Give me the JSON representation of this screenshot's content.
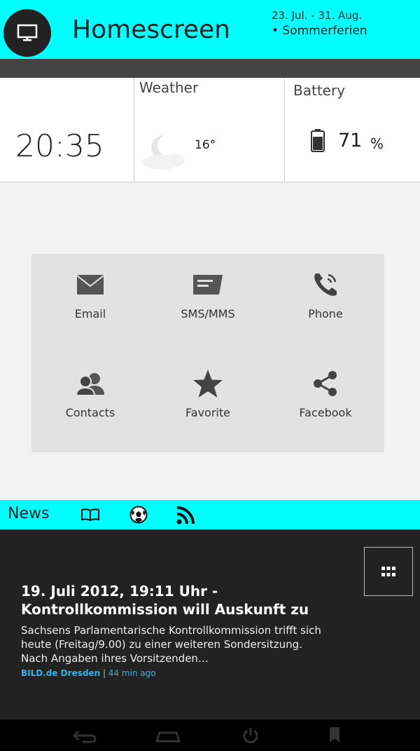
{
  "header": {
    "title": "Homescreen",
    "date_range": "23. Jul. - 31. Aug.",
    "event": "• Sommerferien",
    "home_icon": "monitor-icon"
  },
  "widgets": {
    "clock": {
      "time": "20:35"
    },
    "weather": {
      "label": "Weather",
      "temperature": "16°",
      "icon": "partly-cloudy-icon"
    },
    "battery": {
      "label": "Battery",
      "value": "71",
      "unit": "%",
      "level_percent": 71,
      "icon": "battery-icon"
    }
  },
  "apps": [
    {
      "label": "Email",
      "icon": "envelope-icon"
    },
    {
      "label": "SMS/MMS",
      "icon": "message-icon"
    },
    {
      "label": "Phone",
      "icon": "phone-icon"
    },
    {
      "label": "Contacts",
      "icon": "contacts-icon"
    },
    {
      "label": "Favorite",
      "icon": "star-icon"
    },
    {
      "label": "Facebook",
      "icon": "share-icon"
    }
  ],
  "news_bar": {
    "label": "News",
    "icons": [
      "book-icon",
      "soccer-ball-icon",
      "rss-icon"
    ]
  },
  "feed": {
    "headline": "19. Juli 2012, 19:11 Uhr - Kontrollkommission will Auskunft zu",
    "summary": "Sachsens Parlamentarische Kontrollkommission trifft sich heute (Freitag/9.00) zu einer weiteren Sondersitzung. Nach Angaben ihres Vorsitzenden…",
    "source": "BILD.de Dresden",
    "separator": " | ",
    "time_ago": "44 min ago",
    "grid_icon": "grid-icon"
  },
  "colors": {
    "accent": "#00ffff",
    "dark": "#222222",
    "link": "#33b5e5"
  }
}
